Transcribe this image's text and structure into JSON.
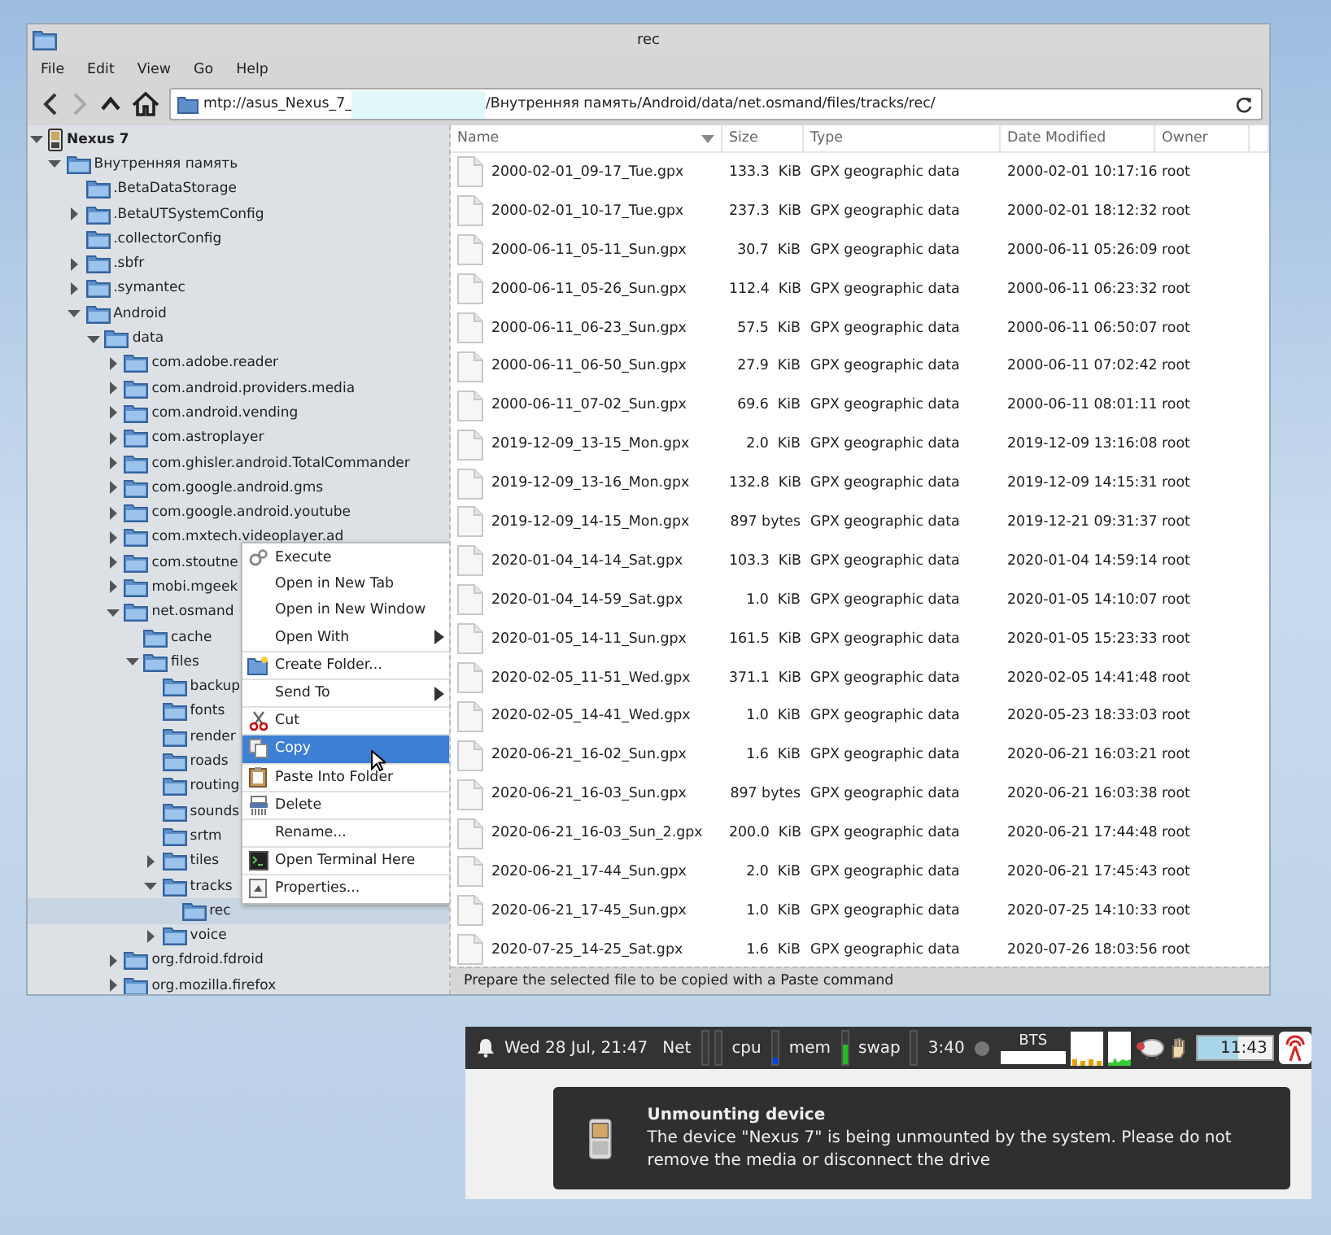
{
  "window": {
    "title": "rec"
  },
  "menu": [
    "File",
    "Edit",
    "View",
    "Go",
    "Help"
  ],
  "nav_buttons": [
    {
      "kind": "back",
      "disabled": false
    },
    {
      "kind": "forward",
      "disabled": true
    },
    {
      "kind": "up",
      "disabled": false
    },
    {
      "kind": "home",
      "disabled": false
    }
  ],
  "address": {
    "start": "mtp://asus_Nexus_7_",
    "end": "/Внутренняя память/Android/data/net.osmand/files/tracks/rec/"
  },
  "tree": [
    {
      "name": "Nexus 7",
      "kind": "device",
      "expanded": true,
      "selected": false,
      "children": [
        {
          "name": "Внутренняя память",
          "kind": "folder",
          "expanded": true,
          "selected": false,
          "children": [
            {
              "name": ".BetaDataStorage",
              "kind": "folder",
              "selected": false
            },
            {
              "name": ".BetaUTSystemConfig",
              "kind": "folder",
              "expanded": false,
              "selected": false
            },
            {
              "name": ".collectorConfig",
              "kind": "folder",
              "selected": false
            },
            {
              "name": ".sbfr",
              "kind": "folder",
              "expanded": false,
              "selected": false
            },
            {
              "name": ".symantec",
              "kind": "folder",
              "expanded": false,
              "selected": false
            },
            {
              "name": "Android",
              "kind": "folder",
              "expanded": true,
              "selected": false,
              "children": [
                {
                  "name": "data",
                  "kind": "folder",
                  "expanded": true,
                  "selected": false,
                  "children": [
                    {
                      "name": "com.adobe.reader",
                      "kind": "folder",
                      "expanded": false,
                      "selected": false
                    },
                    {
                      "name": "com.android.providers.media",
                      "kind": "folder",
                      "expanded": false,
                      "selected": false
                    },
                    {
                      "name": "com.android.vending",
                      "kind": "folder",
                      "expanded": false,
                      "selected": false
                    },
                    {
                      "name": "com.astroplayer",
                      "kind": "folder",
                      "expanded": false,
                      "selected": false
                    },
                    {
                      "name": "com.ghisler.android.TotalCommander",
                      "kind": "folder",
                      "expanded": false,
                      "selected": false
                    },
                    {
                      "name": "com.google.android.gms",
                      "kind": "folder",
                      "expanded": false,
                      "selected": false
                    },
                    {
                      "name": "com.google.android.youtube",
                      "kind": "folder",
                      "expanded": false,
                      "selected": false
                    },
                    {
                      "name": "com.mxtech.videoplayer.ad",
                      "kind": "folder",
                      "expanded": false,
                      "selected": false
                    },
                    {
                      "name": "com.stoutne",
                      "kind": "folder",
                      "expanded": false,
                      "selected": false
                    },
                    {
                      "name": "mobi.mgeek",
                      "kind": "folder",
                      "expanded": false,
                      "selected": false
                    },
                    {
                      "name": "net.osmand",
                      "kind": "folder",
                      "expanded": true,
                      "selected": false,
                      "children": [
                        {
                          "name": "cache",
                          "kind": "folder",
                          "selected": false
                        },
                        {
                          "name": "files",
                          "kind": "folder",
                          "expanded": true,
                          "selected": false,
                          "children": [
                            {
                              "name": "backup",
                              "kind": "folder",
                              "selected": false
                            },
                            {
                              "name": "fonts",
                              "kind": "folder",
                              "selected": false
                            },
                            {
                              "name": "render",
                              "kind": "folder",
                              "selected": false
                            },
                            {
                              "name": "roads",
                              "kind": "folder",
                              "selected": false
                            },
                            {
                              "name": "routing",
                              "kind": "folder",
                              "selected": false
                            },
                            {
                              "name": "sounds",
                              "kind": "folder",
                              "selected": false
                            },
                            {
                              "name": "srtm",
                              "kind": "folder",
                              "selected": false
                            },
                            {
                              "name": "tiles",
                              "kind": "folder",
                              "expanded": false,
                              "selected": false
                            },
                            {
                              "name": "tracks",
                              "kind": "folder",
                              "expanded": true,
                              "selected": false,
                              "children": [
                                {
                                  "name": "rec",
                                  "kind": "folder",
                                  "selected": true
                                }
                              ]
                            },
                            {
                              "name": "voice",
                              "kind": "folder",
                              "expanded": false,
                              "selected": false
                            }
                          ]
                        }
                      ]
                    },
                    {
                      "name": "org.fdroid.fdroid",
                      "kind": "folder",
                      "expanded": false,
                      "selected": false
                    },
                    {
                      "name": "org.mozilla.firefox",
                      "kind": "folder",
                      "expanded": false,
                      "selected": false
                    }
                  ]
                }
              ]
            }
          ]
        }
      ]
    }
  ],
  "context_menu": [
    {
      "label": "Execute",
      "submenu": false,
      "group_start": false,
      "selected": false
    },
    {
      "label": "Open in New Tab",
      "submenu": false,
      "group_start": false,
      "selected": false
    },
    {
      "label": "Open in New Window",
      "submenu": false,
      "group_start": false,
      "selected": false
    },
    {
      "label": "Open With",
      "submenu": true,
      "group_start": false,
      "selected": false
    },
    {
      "label": "Create Folder...",
      "submenu": false,
      "group_start": true,
      "selected": false
    },
    {
      "label": "Send To",
      "submenu": true,
      "group_start": true,
      "selected": false
    },
    {
      "label": "Cut",
      "submenu": false,
      "group_start": true,
      "selected": false
    },
    {
      "label": "Copy",
      "submenu": false,
      "group_start": true,
      "selected": true
    },
    {
      "label": "Paste Into Folder",
      "submenu": false,
      "group_start": true,
      "selected": false
    },
    {
      "label": "Delete",
      "submenu": false,
      "group_start": true,
      "selected": false
    },
    {
      "label": "Rename...",
      "submenu": false,
      "group_start": true,
      "selected": false
    },
    {
      "label": "Open Terminal Here",
      "submenu": false,
      "group_start": true,
      "selected": false
    },
    {
      "label": "Properties...",
      "submenu": false,
      "group_start": true,
      "selected": false
    }
  ],
  "columns": [
    {
      "label": "Name",
      "sorted": true
    },
    {
      "label": "Size",
      "sorted": false
    },
    {
      "label": "Type",
      "sorted": false
    },
    {
      "label": "Date Modified",
      "sorted": false
    },
    {
      "label": "Owner",
      "sorted": false
    }
  ],
  "files": [
    {
      "name": "2000-02-01_09-17_Tue.gpx",
      "size": "133.3  KiB",
      "type": "GPX geographic data",
      "modified": "2000-02-01 10:17:16",
      "owner": "root"
    },
    {
      "name": "2000-02-01_10-17_Tue.gpx",
      "size": "237.3  KiB",
      "type": "GPX geographic data",
      "modified": "2000-02-01 18:12:32",
      "owner": "root"
    },
    {
      "name": "2000-06-11_05-11_Sun.gpx",
      "size": "30.7  KiB",
      "type": "GPX geographic data",
      "modified": "2000-06-11 05:26:09",
      "owner": "root"
    },
    {
      "name": "2000-06-11_05-26_Sun.gpx",
      "size": "112.4  KiB",
      "type": "GPX geographic data",
      "modified": "2000-06-11 06:23:32",
      "owner": "root"
    },
    {
      "name": "2000-06-11_06-23_Sun.gpx",
      "size": "57.5  KiB",
      "type": "GPX geographic data",
      "modified": "2000-06-11 06:50:07",
      "owner": "root"
    },
    {
      "name": "2000-06-11_06-50_Sun.gpx",
      "size": "27.9  KiB",
      "type": "GPX geographic data",
      "modified": "2000-06-11 07:02:42",
      "owner": "root"
    },
    {
      "name": "2000-06-11_07-02_Sun.gpx",
      "size": "69.6  KiB",
      "type": "GPX geographic data",
      "modified": "2000-06-11 08:01:11",
      "owner": "root"
    },
    {
      "name": "2019-12-09_13-15_Mon.gpx",
      "size": "2.0  KiB",
      "type": "GPX geographic data",
      "modified": "2019-12-09 13:16:08",
      "owner": "root"
    },
    {
      "name": "2019-12-09_13-16_Mon.gpx",
      "size": "132.8  KiB",
      "type": "GPX geographic data",
      "modified": "2019-12-09 14:15:31",
      "owner": "root"
    },
    {
      "name": "2019-12-09_14-15_Mon.gpx",
      "size": "897 bytes",
      "type": "GPX geographic data",
      "modified": "2019-12-21 09:31:37",
      "owner": "root"
    },
    {
      "name": "2020-01-04_14-14_Sat.gpx",
      "size": "103.3  KiB",
      "type": "GPX geographic data",
      "modified": "2020-01-04 14:59:14",
      "owner": "root"
    },
    {
      "name": "2020-01-04_14-59_Sat.gpx",
      "size": "1.0  KiB",
      "type": "GPX geographic data",
      "modified": "2020-01-05 14:10:07",
      "owner": "root"
    },
    {
      "name": "2020-01-05_14-11_Sun.gpx",
      "size": "161.5  KiB",
      "type": "GPX geographic data",
      "modified": "2020-01-05 15:23:33",
      "owner": "root"
    },
    {
      "name": "2020-02-05_11-51_Wed.gpx",
      "size": "371.1  KiB",
      "type": "GPX geographic data",
      "modified": "2020-02-05 14:41:48",
      "owner": "root"
    },
    {
      "name": "2020-02-05_14-41_Wed.gpx",
      "size": "1.0  KiB",
      "type": "GPX geographic data",
      "modified": "2020-05-23 18:33:03",
      "owner": "root"
    },
    {
      "name": "2020-06-21_16-02_Sun.gpx",
      "size": "1.6  KiB",
      "type": "GPX geographic data",
      "modified": "2020-06-21 16:03:21",
      "owner": "root"
    },
    {
      "name": "2020-06-21_16-03_Sun.gpx",
      "size": "897 bytes",
      "type": "GPX geographic data",
      "modified": "2020-06-21 16:03:38",
      "owner": "root"
    },
    {
      "name": "2020-06-21_16-03_Sun_2.gpx",
      "size": "200.0  KiB",
      "type": "GPX geographic data",
      "modified": "2020-06-21 17:44:48",
      "owner": "root"
    },
    {
      "name": "2020-06-21_17-44_Sun.gpx",
      "size": "2.0  KiB",
      "type": "GPX geographic data",
      "modified": "2020-06-21 17:45:43",
      "owner": "root"
    },
    {
      "name": "2020-06-21_17-45_Sun.gpx",
      "size": "1.0  KiB",
      "type": "GPX geographic data",
      "modified": "2020-07-25 14:10:33",
      "owner": "root"
    },
    {
      "name": "2020-07-25_14-25_Sat.gpx",
      "size": "1.6  KiB",
      "type": "GPX geographic data",
      "modified": "2020-07-26 18:03:56",
      "owner": "root"
    }
  ],
  "status_bar": "Prepare the selected file to be copied with a Paste command",
  "taskbar": {
    "datetime": "Wed 28 Jul, 21:47",
    "net_label": "Net",
    "monitors": [
      {
        "label": "cpu",
        "level": 0.2,
        "color": "#0044ee"
      },
      {
        "label": "mem",
        "level": 0.6,
        "color": "#22bb22"
      },
      {
        "label": "swap"
      }
    ],
    "uptime": "3:40",
    "bts_label": "BTS",
    "timer": {
      "text": "11:43",
      "level": 0.55
    }
  },
  "notification": {
    "title": "Unmounting device",
    "body": "The device \"Nexus 7\" is being unmounted by the system. Please do not remove the media or disconnect the drive"
  }
}
